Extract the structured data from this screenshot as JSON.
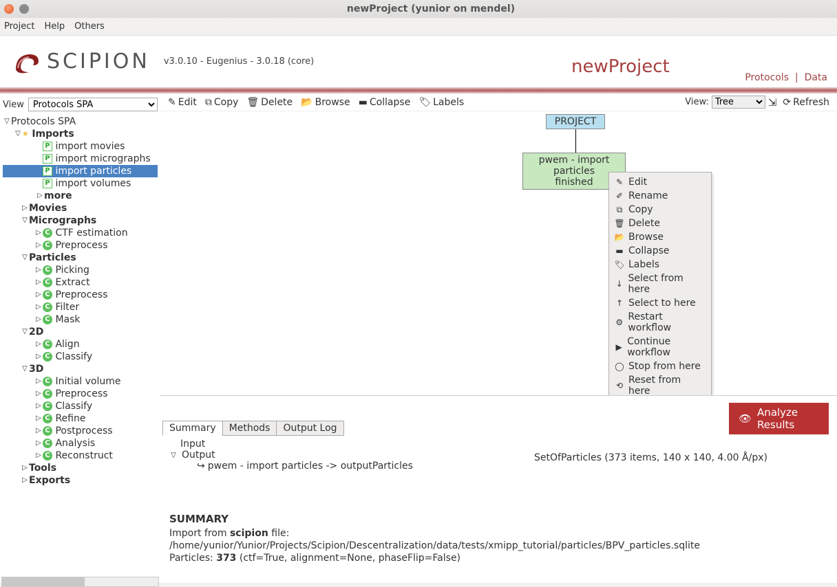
{
  "titlebar": {
    "title": "newProject (yunior on mendel)"
  },
  "menubar": {
    "project": "Project",
    "help": "Help",
    "others": "Others"
  },
  "header": {
    "logo_text": "SCIPION",
    "version": "v3.0.10 - Eugenius - 3.0.18 (core)",
    "project_name": "newProject",
    "link_protocols": "Protocols",
    "link_data": "Data"
  },
  "sidebar": {
    "view_label": "View",
    "view_value": "Protocols SPA",
    "root": "Protocols SPA",
    "imports": {
      "label": "Imports",
      "movies": "import movies",
      "micrographs": "import micrographs",
      "particles": "import particles",
      "volumes": "import volumes",
      "more": "more"
    },
    "movies": "Movies",
    "micrographs": {
      "label": "Micrographs",
      "ctf": "CTF estimation",
      "preprocess": "Preprocess"
    },
    "particles": {
      "label": "Particles",
      "picking": "Picking",
      "extract": "Extract",
      "preprocess": "Preprocess",
      "filter": "Filter",
      "mask": "Mask"
    },
    "twod": {
      "label": "2D",
      "align": "Align",
      "classify": "Classify"
    },
    "threed": {
      "label": "3D",
      "initvol": "Initial volume",
      "preprocess": "Preprocess",
      "classify": "Classify",
      "refine": "Refine",
      "postprocess": "Postprocess",
      "analysis": "Analysis",
      "reconstruct": "Reconstruct"
    },
    "tools": "Tools",
    "exports": "Exports"
  },
  "toolbar": {
    "edit": "Edit",
    "copy": "Copy",
    "delete": "Delete",
    "browse": "Browse",
    "collapse": "Collapse",
    "labels": "Labels",
    "view_label": "View:",
    "view_value": "Tree",
    "refresh": "Refresh"
  },
  "canvas": {
    "project": "PROJECT",
    "node_title": "pwem - import particles",
    "node_status": "finished"
  },
  "context_menu": {
    "edit": "Edit",
    "rename": "Rename",
    "copy": "Copy",
    "delete": "Delete",
    "browse": "Browse",
    "collapse": "Collapse",
    "labels": "Labels",
    "select_from": "Select from here",
    "select_to": "Select to here",
    "restart_wf": "Restart workflow",
    "continue_wf": "Continue workflow",
    "stop_from": "Stop from here",
    "reset_from": "Reset from here"
  },
  "bottom": {
    "analyze": "Analyze Results",
    "tab_summary": "Summary",
    "tab_methods": "Methods",
    "tab_outputlog": "Output Log",
    "input": "Input",
    "output": "Output",
    "out_link": "pwem - import particles -> outputParticles",
    "out_set": "SetOfParticles (373 items, 140 x 140, 4.00 Å/px)",
    "summary_h": "SUMMARY",
    "sum_l1_a": "Import from ",
    "sum_l1_b": "scipion",
    "sum_l1_c": " file:",
    "sum_l2": "/home/yunior/Yunior/Projects/Scipion/Descentralization/data/tests/xmipp_tutorial/particles/BPV_particles.sqlite",
    "sum_l3_a": " Particles: ",
    "sum_l3_b": "373",
    "sum_l3_c": " (ctf=True, alignment=None, phaseFlip=False)"
  }
}
